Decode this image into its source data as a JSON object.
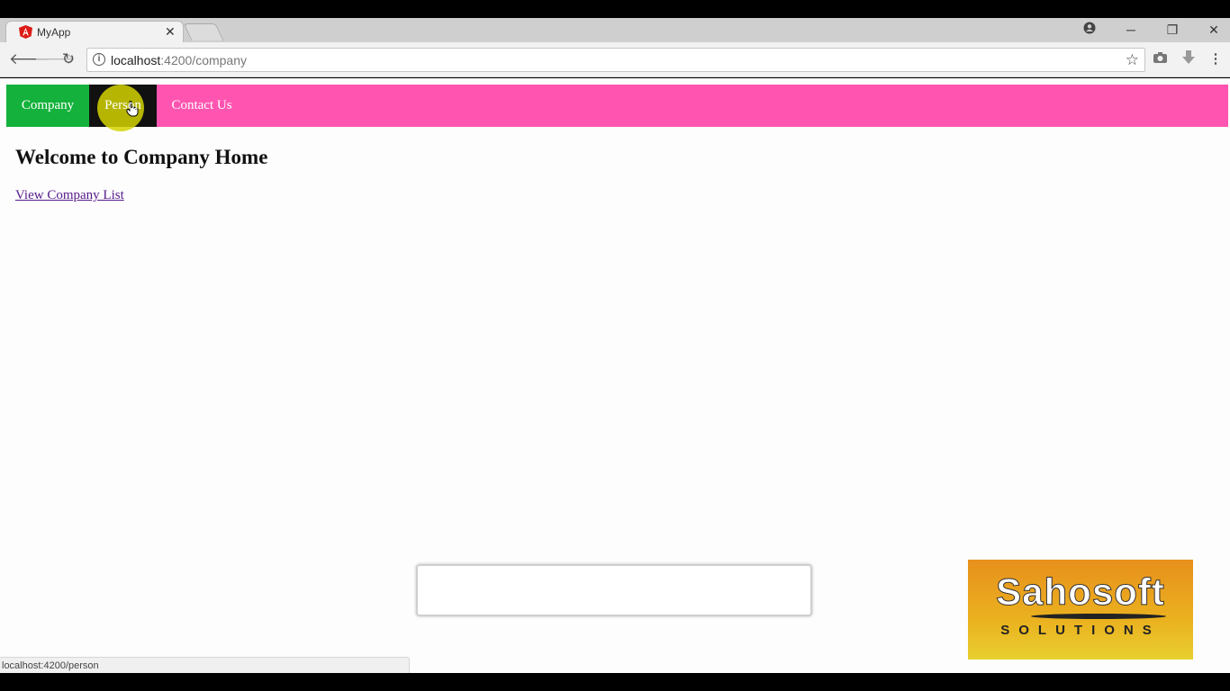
{
  "browser": {
    "tab_title": "MyApp",
    "tab_close": "✕",
    "url_host": "localhost",
    "url_path": ":4200/company",
    "window_controls": {
      "minimize": "─",
      "restore": "❐",
      "close": "✕"
    },
    "icons": {
      "back": "arrow-left-icon",
      "forward": "arrow-right-icon",
      "reload": "reload-icon",
      "info": "info-icon",
      "star": "star-icon",
      "camera": "camera-icon",
      "download": "download-icon",
      "menu": "kebab-menu-icon",
      "account": "account-icon"
    },
    "status_url": "localhost:4200/person"
  },
  "navbar": {
    "items": [
      {
        "label": "Company"
      },
      {
        "label": "Person"
      },
      {
        "label": "Contact Us"
      }
    ],
    "colors": {
      "bar": "#ff55b0",
      "company": "#14b23c",
      "person": "#111111"
    }
  },
  "main": {
    "heading": "Welcome to Company Home",
    "link": "View Company List"
  },
  "watermark": {
    "brand": "Sahosoft",
    "tagline": "SOLUTIONS"
  }
}
